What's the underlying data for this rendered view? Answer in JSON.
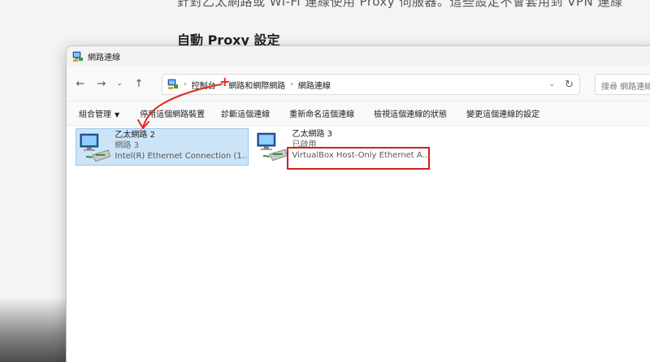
{
  "background_page": {
    "top_line": "針對乙太網路或 Wi-Fi 連線使用 Proxy 伺服器。這些設定不會套用到 VPN 連線",
    "heading": "自動 Proxy 設定"
  },
  "window": {
    "title": "網路連線",
    "nav": {
      "back": "←",
      "forward": "→",
      "recent": "⌄",
      "up": "↑"
    },
    "breadcrumb": [
      "控制台",
      "網路和網際網路",
      "網路連線"
    ],
    "breadcrumb_sep": "›",
    "search_placeholder": "搜尋 網路連線",
    "commands": {
      "organize": "組合管理",
      "disable": "停用這個網路裝置",
      "diagnose": "診斷這個連線",
      "rename": "重新命名這個連線",
      "status": "檢視這個連線的狀態",
      "settings": "變更這個連線的設定"
    },
    "connections": [
      {
        "name": "乙太網路 2",
        "network": "網路 3",
        "device": "Intel(R) Ethernet Connection (1...",
        "selected": true
      },
      {
        "name": "乙太網路 3",
        "network": "已啟用",
        "device": "VirtualBox Host-Only Ethernet A...",
        "selected": false
      }
    ]
  },
  "annotations": {
    "highlight_color": "#d4201a",
    "arrow_color": "#e0281f",
    "plus_mark": "+"
  },
  "colors": {
    "selected_bg": "#cce4f7",
    "selected_border": "#99c9ef"
  }
}
